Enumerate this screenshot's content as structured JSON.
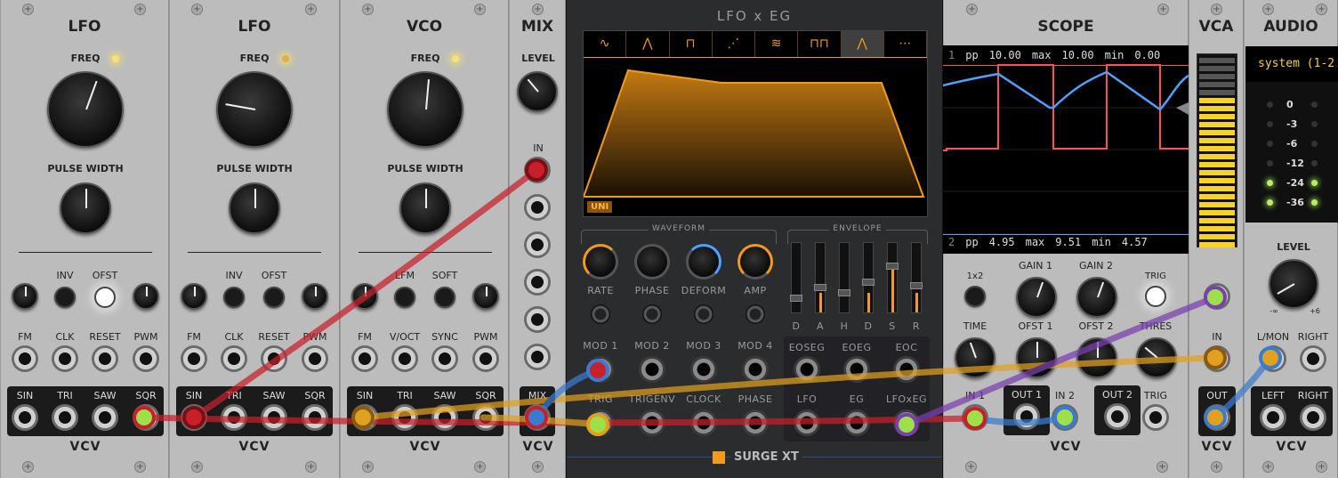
{
  "modules": {
    "lfo1": {
      "title": "LFO",
      "freq": "FREQ",
      "pw": "PULSE WIDTH",
      "inv": "INV",
      "ofst": "OFST",
      "fm": "FM",
      "clk": "CLK",
      "reset": "RESET",
      "pwm": "PWM",
      "outs": [
        "SIN",
        "TRI",
        "SAW",
        "SQR"
      ],
      "logo": "VCV"
    },
    "lfo2": {
      "title": "LFO",
      "freq": "FREQ",
      "pw": "PULSE WIDTH",
      "inv": "INV",
      "ofst": "OFST",
      "fm": "FM",
      "clk": "CLK",
      "reset": "RESET",
      "pwm": "PWM",
      "outs": [
        "SIN",
        "TRI",
        "SAW",
        "SQR"
      ],
      "logo": "VCV"
    },
    "vco": {
      "title": "VCO",
      "freq": "FREQ",
      "pw": "PULSE WIDTH",
      "lfm": "LFM",
      "soft": "SOFT",
      "fm": "FM",
      "voct": "V/OCT",
      "sync": "SYNC",
      "pwm": "PWM",
      "outs": [
        "SIN",
        "TRI",
        "SAW",
        "SQR"
      ],
      "logo": "VCV"
    },
    "mix": {
      "title": "MIX",
      "level": "LEVEL",
      "in": "IN",
      "out": "MIX",
      "logo": "VCV"
    },
    "surge": {
      "title": "LFO x EG",
      "uni": "UNI",
      "waveform_section": "WAVEFORM",
      "envelope_section": "ENVELOPE",
      "knobs": [
        "RATE",
        "PHASE",
        "DEFORM",
        "AMP"
      ],
      "env": [
        "D",
        "A",
        "H",
        "D",
        "S",
        "R"
      ],
      "mods": [
        "MOD 1",
        "MOD 2",
        "MOD 3",
        "MOD 4"
      ],
      "trigs": [
        "TRIG",
        "TRIGENV",
        "CLOCK",
        "PHASE"
      ],
      "eoutsTop": [
        "EOSEG",
        "EOEG",
        "EOC"
      ],
      "eoutsBot": [
        "LFO",
        "EG",
        "LFOxEG"
      ],
      "brand": "SURGE XT"
    },
    "scope": {
      "title": "SCOPE",
      "row1": {
        "ch": "1",
        "pp_l": "pp",
        "pp": "10.00",
        "max_l": "max",
        "max": "10.00",
        "min_l": "min",
        "min": "0.00"
      },
      "row2": {
        "ch": "2",
        "pp_l": "pp",
        "pp": "4.95",
        "max_l": "max",
        "max": "9.51",
        "min_l": "min",
        "min": "4.57"
      },
      "x12": "1x2",
      "gain1": "GAIN 1",
      "gain2": "GAIN 2",
      "trig": "TRIG",
      "time": "TIME",
      "ofst1": "OFST 1",
      "ofst2": "OFST 2",
      "thres": "THRES",
      "in1": "IN 1",
      "out1": "OUT 1",
      "in2": "IN 2",
      "out2": "OUT 2",
      "trigIn": "TRIG",
      "logo": "VCV"
    },
    "vca": {
      "title": "VCA",
      "in": "IN",
      "out": "OUT",
      "logo": "VCV"
    },
    "audio": {
      "title": "AUDIO",
      "device": "system (1-2",
      "db": [
        "0",
        "-3",
        "-6",
        "-12",
        "-24",
        "-36"
      ],
      "level": "LEVEL",
      "min": "-∞",
      "max": "+6",
      "lmon": "L/MON",
      "right": "RIGHT",
      "left": "LEFT",
      "right2": "RIGHT",
      "logo": "VCV"
    }
  },
  "colors": {
    "accent": "#f29a1c",
    "cable_red": "#c8202a",
    "cable_orange": "#e0a020",
    "cable_blue": "#3a7bd0",
    "cable_purple": "#7a3fb0",
    "scope_blue": "#4aa3ff",
    "scope_red": "#ff4d5e",
    "meter_yellow": "#f7d22b"
  }
}
